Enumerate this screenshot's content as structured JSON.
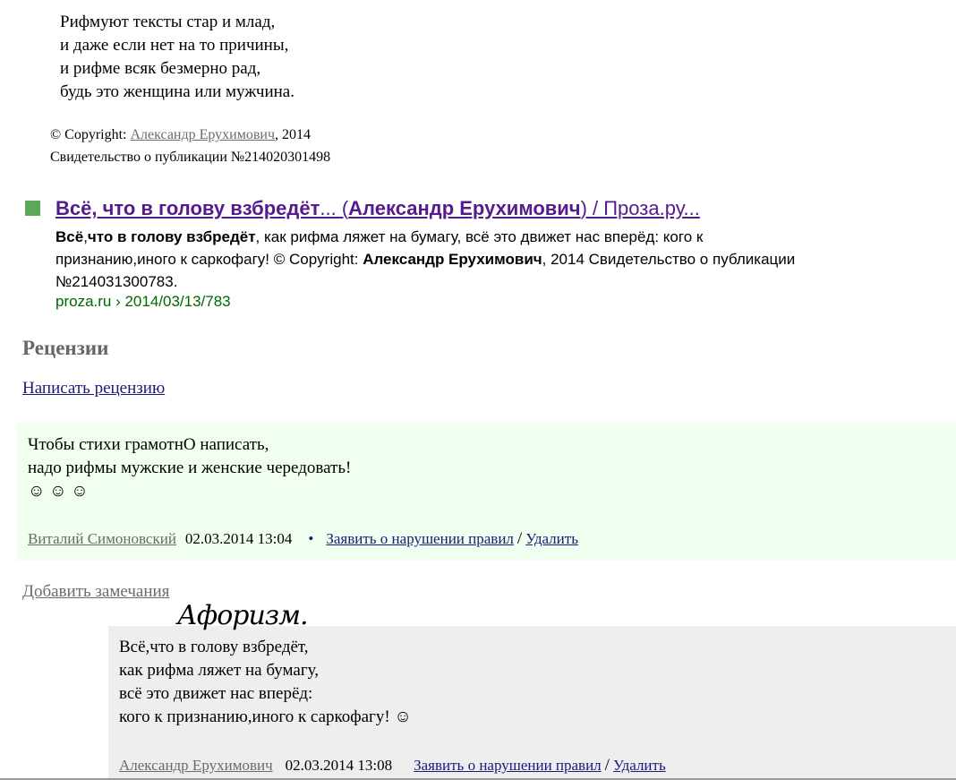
{
  "poem": {
    "lines": [
      "Рифмуют тексты стар и млад,",
      "и даже если нет на то причины,",
      "и рифме всяк безмерно рад,",
      "будь это женщина или мужчина."
    ]
  },
  "copyright": {
    "prefix": "© Copyright: ",
    "author": "Александр Ерухимович",
    "year": ", 2014",
    "certificate": "Свидетельство о публикации №214020301498"
  },
  "search_result": {
    "title_bold1": "Всё, что в голову взбредёт",
    "title_mid": "... (",
    "title_bold2": "Александр Ерухимович",
    "title_end": ") / Проза.ру...",
    "snippet": {
      "b1": "Всё",
      "t1": ",",
      "b2": "что в голову взбредёт",
      "t2": ", как рифма ляжет на бумагу, всё это движет нас вперёд: кого к признанию,иного к саркофагу! © Copyright: ",
      "b3": "Александр Ерухимович",
      "t3": ", 2014 Свидетельство о публикации №214031300783."
    },
    "url": "proza.ru › 2014/03/13/783",
    "accent_color": "#5aa85a"
  },
  "reviews": {
    "heading": "Рецензии",
    "write_link": "Написать рецензию",
    "add_remarks": "Добавить замечания",
    "items": [
      {
        "lines": [
          "Чтобы стихи грамотнО написать,",
          "надо рифмы мужские и женские чередовать!",
          "☺ ☺ ☺"
        ],
        "author": "Виталий Симоновский",
        "date": "02.03.2014 13:04",
        "bullet": "•",
        "report": "Заявить о нарушении правил",
        "separator": "/",
        "delete": "Удалить",
        "bg": "#f0fff0"
      },
      {
        "heading": "Афоризм.",
        "lines": [
          "Всё,что в голову взбредёт,",
          "как рифма ляжет на бумагу,",
          "всё это движет нас вперёд:",
          "кого к признанию,иного к саркофагу! ☺"
        ],
        "author": "Александр Ерухимович",
        "date": "02.03.2014 13:08",
        "report": "Заявить о нарушении правил",
        "separator": "/",
        "delete": "Удалить",
        "bg": "#eeeeee"
      }
    ]
  }
}
